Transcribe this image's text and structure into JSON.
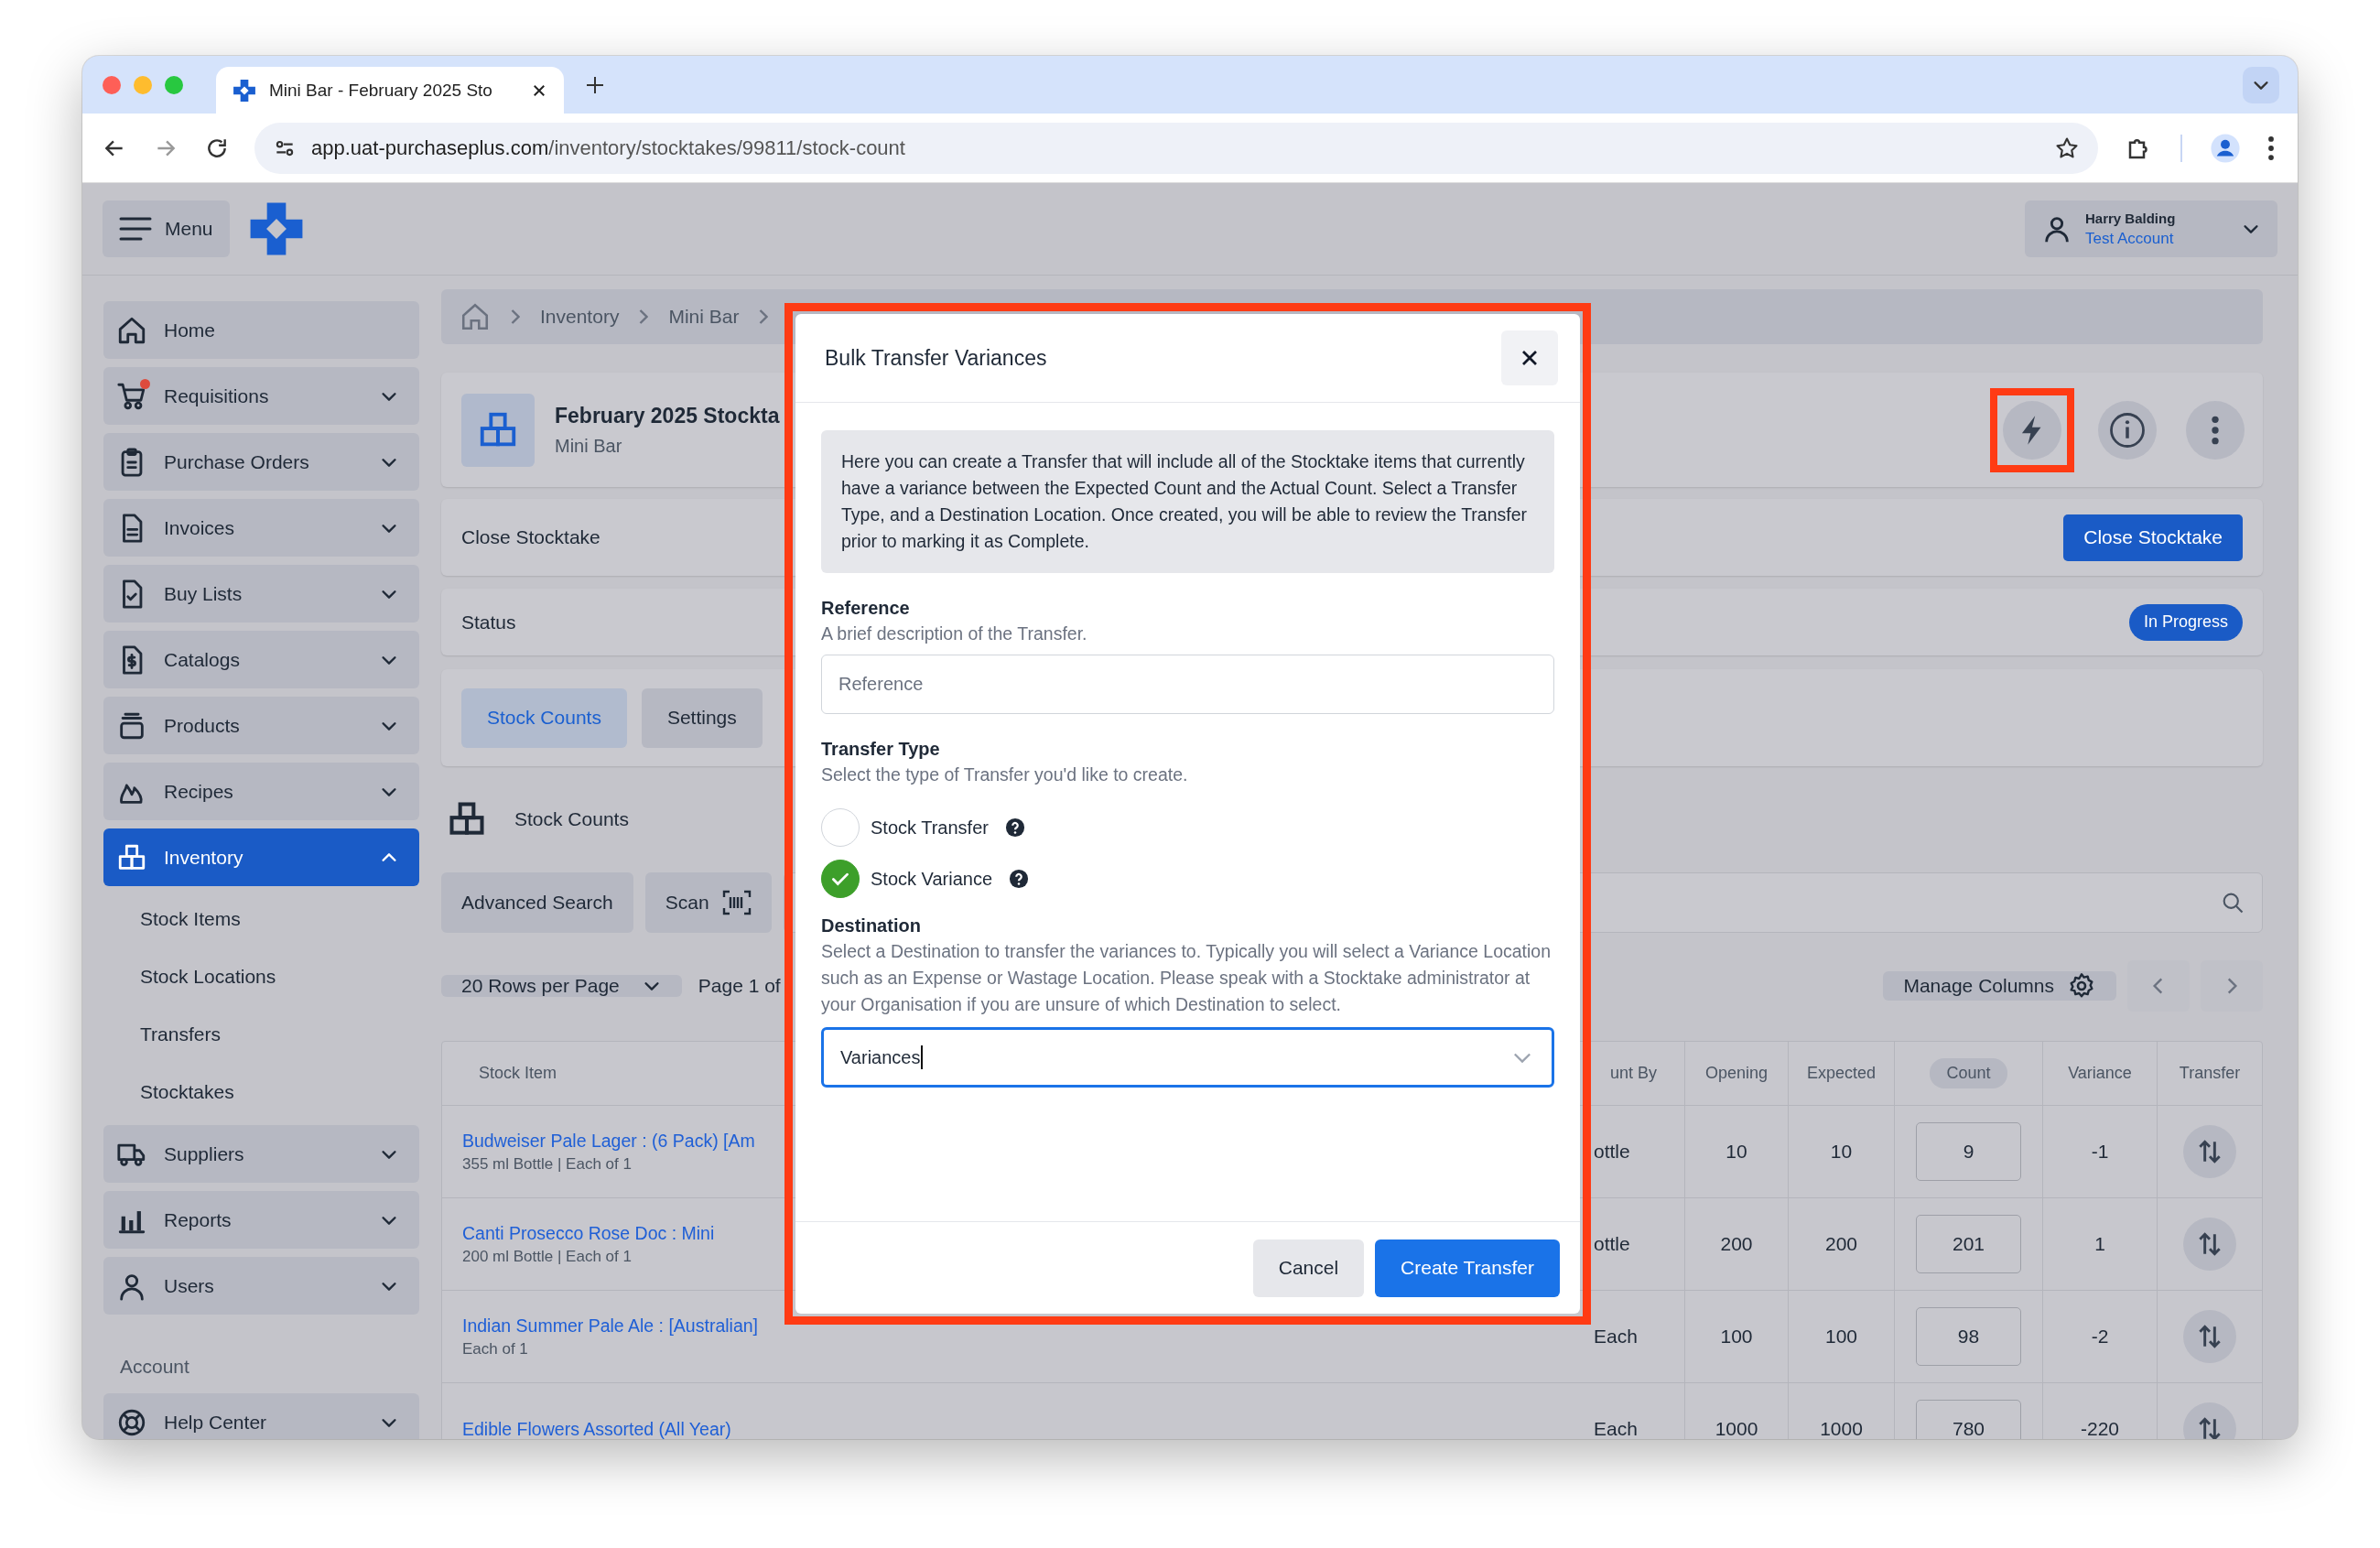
{
  "browser": {
    "tab_title": "Mini Bar - February 2025 Sto",
    "url_host": "app.uat-purchaseplus.com",
    "url_path": "/inventory/stocktakes/99811/stock-count"
  },
  "header": {
    "menu_label": "Menu",
    "user_name": "Harry Balding",
    "account": "Test Account"
  },
  "sidebar": {
    "items": [
      {
        "label": "Home",
        "kind": "link",
        "notification": false
      },
      {
        "label": "Requisitions",
        "kind": "group",
        "expanded": false,
        "notification": true
      },
      {
        "label": "Purchase Orders",
        "kind": "group",
        "expanded": false,
        "notification": false
      },
      {
        "label": "Invoices",
        "kind": "group",
        "expanded": false,
        "notification": false
      },
      {
        "label": "Buy Lists",
        "kind": "group",
        "expanded": false,
        "notification": false
      },
      {
        "label": "Catalogs",
        "kind": "group",
        "expanded": false,
        "notification": false
      },
      {
        "label": "Products",
        "kind": "group",
        "expanded": false,
        "notification": false
      },
      {
        "label": "Recipes",
        "kind": "group",
        "expanded": false,
        "notification": false
      },
      {
        "label": "Inventory",
        "kind": "group",
        "expanded": true,
        "selected": true,
        "notification": false,
        "children": [
          {
            "label": "Stock Items"
          },
          {
            "label": "Stock Locations"
          },
          {
            "label": "Transfers"
          },
          {
            "label": "Stocktakes"
          }
        ]
      },
      {
        "label": "Suppliers",
        "kind": "group",
        "expanded": false,
        "notification": false
      },
      {
        "label": "Reports",
        "kind": "group",
        "expanded": false,
        "notification": false
      },
      {
        "label": "Users",
        "kind": "group",
        "expanded": false,
        "notification": false
      }
    ],
    "section_label": "Account",
    "account_items": [
      {
        "label": "Help Center",
        "kind": "group",
        "expanded": false
      }
    ]
  },
  "breadcrumb": [
    "Inventory",
    "Mini Bar"
  ],
  "stocktake": {
    "title": "February 2025 Stockta",
    "subtitle": "Mini Bar",
    "quick_action_highlighted": true
  },
  "close_row": {
    "label": "Close Stocktake",
    "button": "Close Stocktake"
  },
  "status_row": {
    "label": "Status",
    "badge": "In Progress"
  },
  "tabs": [
    {
      "label": "Stock Counts",
      "selected": true
    },
    {
      "label": "Settings",
      "selected": false
    }
  ],
  "section_title": "Stock Counts",
  "toolbar": {
    "advanced_search": "Advanced Search",
    "scan": "Scan"
  },
  "pagination": {
    "rows_per_page": "20 Rows per Page",
    "page": "Page 1 of",
    "manage_columns": "Manage Columns"
  },
  "table": {
    "columns": [
      {
        "label": "Stock Item",
        "highlighted": false
      },
      {
        "label": "unt By",
        "highlighted": false
      },
      {
        "label": "Opening",
        "highlighted": false
      },
      {
        "label": "Expected",
        "highlighted": false
      },
      {
        "label": "Count",
        "highlighted": true
      },
      {
        "label": "Variance",
        "highlighted": false
      },
      {
        "label": "Transfer",
        "highlighted": false
      }
    ],
    "rows": [
      {
        "name": "Budweiser Pale Lager : (6 Pack) [Am",
        "detail": "355 ml Bottle | Each of 1",
        "count_by": "ottle",
        "opening": "10",
        "expected": "10",
        "count": "9",
        "variance": "-1"
      },
      {
        "name": "Canti Prosecco Rose Doc : Mini",
        "detail": "200 ml Bottle | Each of 1",
        "count_by": "ottle",
        "opening": "200",
        "expected": "200",
        "count": "201",
        "variance": "1"
      },
      {
        "name": "Indian Summer Pale Ale : [Australian]",
        "detail": "Each of 1",
        "count_by": "Each",
        "opening": "100",
        "expected": "100",
        "count": "98",
        "variance": "-2"
      },
      {
        "name": "Edible Flowers Assorted (All Year)",
        "count_by": "Each",
        "opening": "1000",
        "expected": "1000",
        "count": "780",
        "variance": "-220"
      }
    ]
  },
  "modal": {
    "title": "Bulk Transfer Variances",
    "highlighted": true,
    "intro": "Here you can create a Transfer that will include all of the Stocktake items that currently have a variance between the Expected Count and the Actual Count. Select a Transfer Type, and a Destination Location. Once created, you will be able to review the Transfer prior to marking it as Complete.",
    "reference": {
      "label": "Reference",
      "hint": "A brief description of the Transfer.",
      "placeholder": "Reference"
    },
    "transfer_type": {
      "label": "Transfer Type",
      "hint": "Select the type of Transfer you'd like to create.",
      "options": [
        {
          "label": "Stock Transfer",
          "selected": false
        },
        {
          "label": "Stock Variance",
          "selected": true
        }
      ]
    },
    "destination": {
      "label": "Destination",
      "hint": "Select a Destination to transfer the variances to. Typically you will select a Variance Location such as an Expense or Wastage Location. Please speak with a Stocktake administrator at your Organisation if you are unsure of which Destination to select.",
      "value": "Variances",
      "focused": true
    },
    "buttons": {
      "cancel": "Cancel",
      "submit": "Create Transfer"
    }
  }
}
